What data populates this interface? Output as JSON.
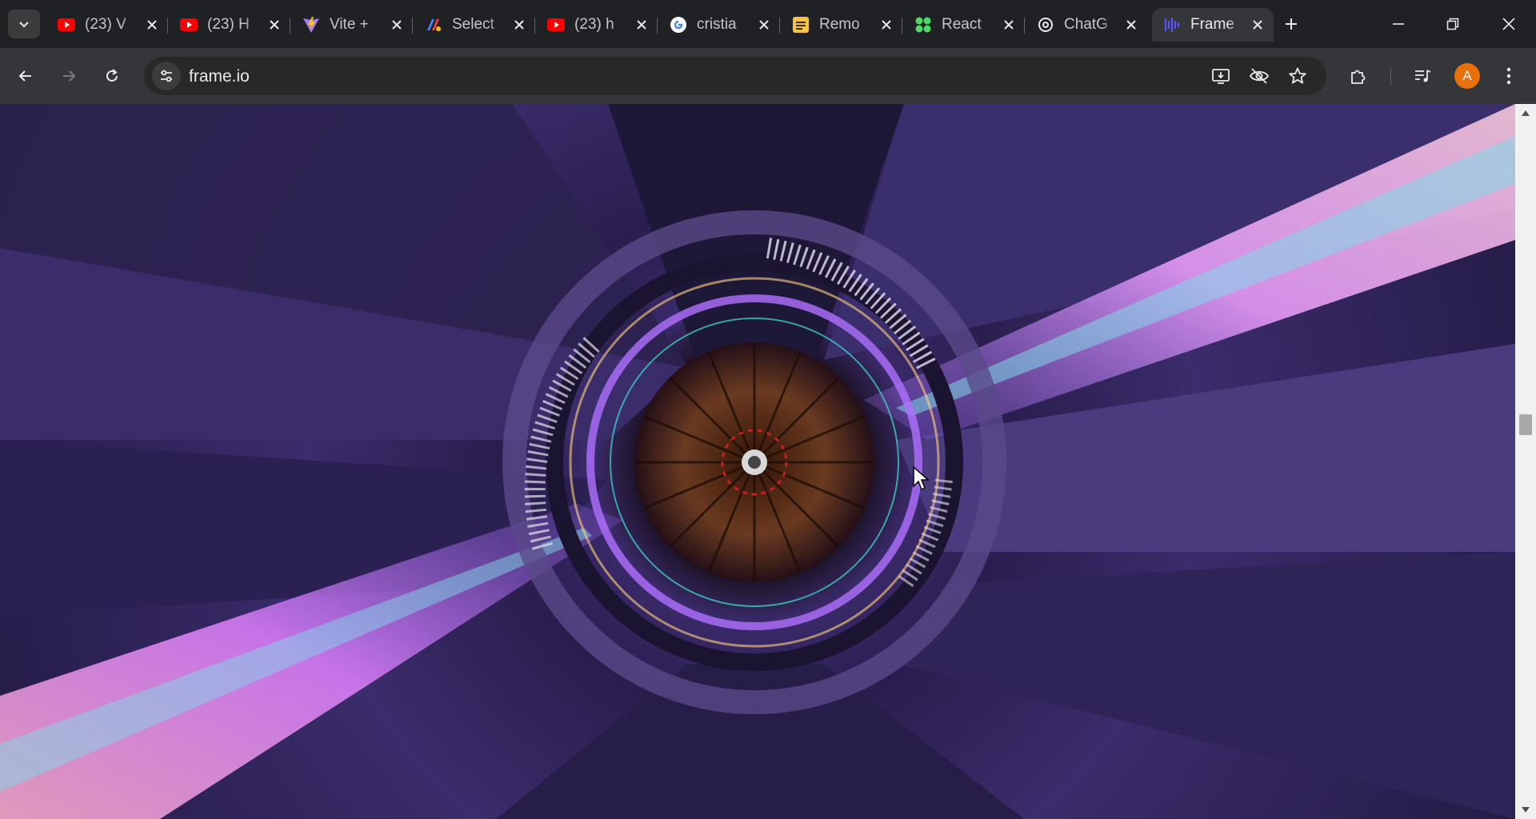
{
  "tabs": [
    {
      "title": "(23) V",
      "icon": "youtube-icon"
    },
    {
      "title": "(23) H",
      "icon": "youtube-icon"
    },
    {
      "title": "Vite +",
      "icon": "vite-icon"
    },
    {
      "title": "Select",
      "icon": "app-icon"
    },
    {
      "title": "(23) h",
      "icon": "youtube-icon"
    },
    {
      "title": "cristia",
      "icon": "google-icon"
    },
    {
      "title": "Remo",
      "icon": "remotion-icon"
    },
    {
      "title": "React",
      "icon": "react-flow-icon"
    },
    {
      "title": "ChatG",
      "icon": "chatgpt-icon"
    },
    {
      "title": "Frame",
      "icon": "frameio-icon",
      "active": true
    }
  ],
  "address_bar": {
    "url": "frame.io"
  },
  "profile": {
    "initial": "A",
    "color": "#e8710a"
  },
  "colors": {
    "youtube": "#ff0000",
    "frameio": "#5b53ff",
    "accent": "#e8710a"
  }
}
